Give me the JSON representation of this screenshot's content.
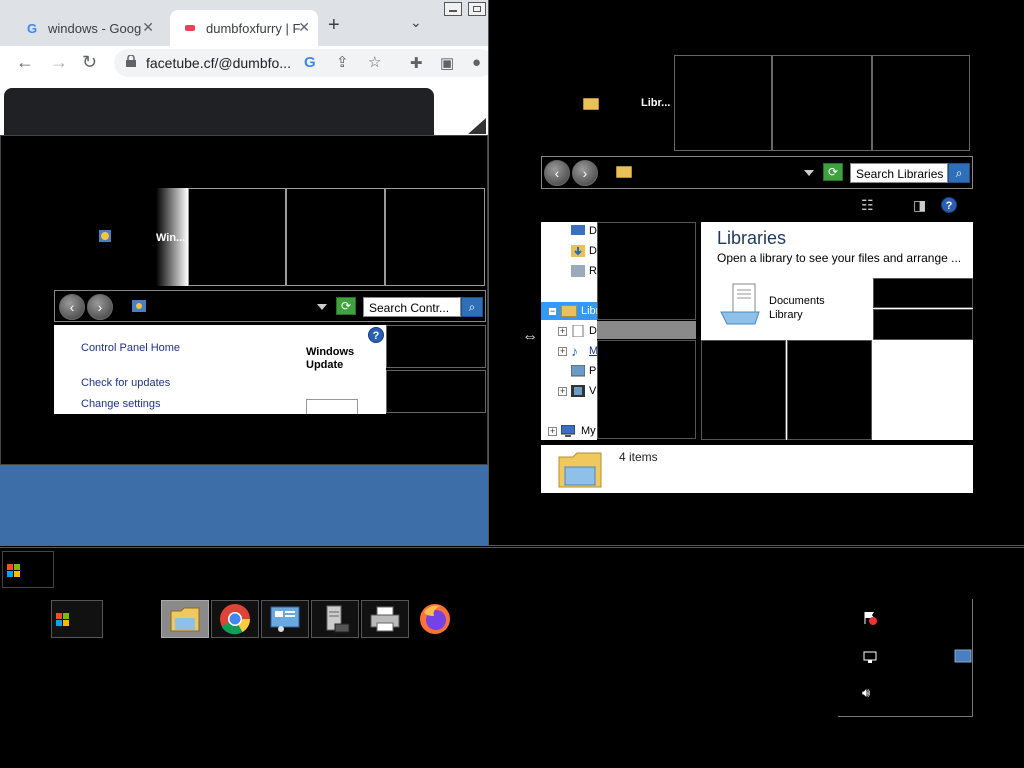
{
  "chrome": {
    "tabs": [
      {
        "label": "windows - Goog",
        "favicon": "google-favicon",
        "active": false
      },
      {
        "label": "dumbfoxfurry | F",
        "favicon": "site-favicon",
        "active": true
      }
    ],
    "new_tab": "+",
    "tab_menu": "⌄",
    "url": "facetube.cf/@dumbfo..."
  },
  "control_panel": {
    "title": "Win...",
    "search_placeholder": "Search Contr...",
    "links": [
      "Control Panel Home",
      "Check for updates",
      "Change settings"
    ],
    "heading_line1": "Windows",
    "heading_line2": "Update",
    "help": "?"
  },
  "explorer": {
    "title": "Libr...",
    "search_placeholder": "Search Libraries",
    "help": "?",
    "tree": [
      {
        "label": "D",
        "icon": "desktop-icon"
      },
      {
        "label": "D",
        "icon": "downloads-icon"
      },
      {
        "label": "R",
        "icon": "recent-icon"
      },
      {
        "label": "Libr",
        "icon": "libraries-icon",
        "selected": true
      },
      {
        "label": "D",
        "icon": "documents-icon"
      },
      {
        "label": "Music",
        "icon": "music-icon",
        "hover": true
      },
      {
        "label": "P",
        "icon": "pictures-icon"
      },
      {
        "label": "V",
        "icon": "videos-icon"
      },
      {
        "label": "My",
        "icon": "computer-icon"
      }
    ],
    "main_title": "Libraries",
    "main_subtitle": "Open a library to see your files and arrange ...",
    "library_item_line1": "Documents",
    "library_item_line2": "Library",
    "item_count": "4 items"
  },
  "colors": {
    "accent_blue": "#3e6ea8",
    "selection": "#3399ff",
    "link": "#1e3287"
  },
  "taskbar": {
    "buttons": [
      "start-button",
      "explorer-button",
      "chrome-button",
      "control-panel-button",
      "server-manager-button",
      "printer-button",
      "firefox-button"
    ]
  }
}
